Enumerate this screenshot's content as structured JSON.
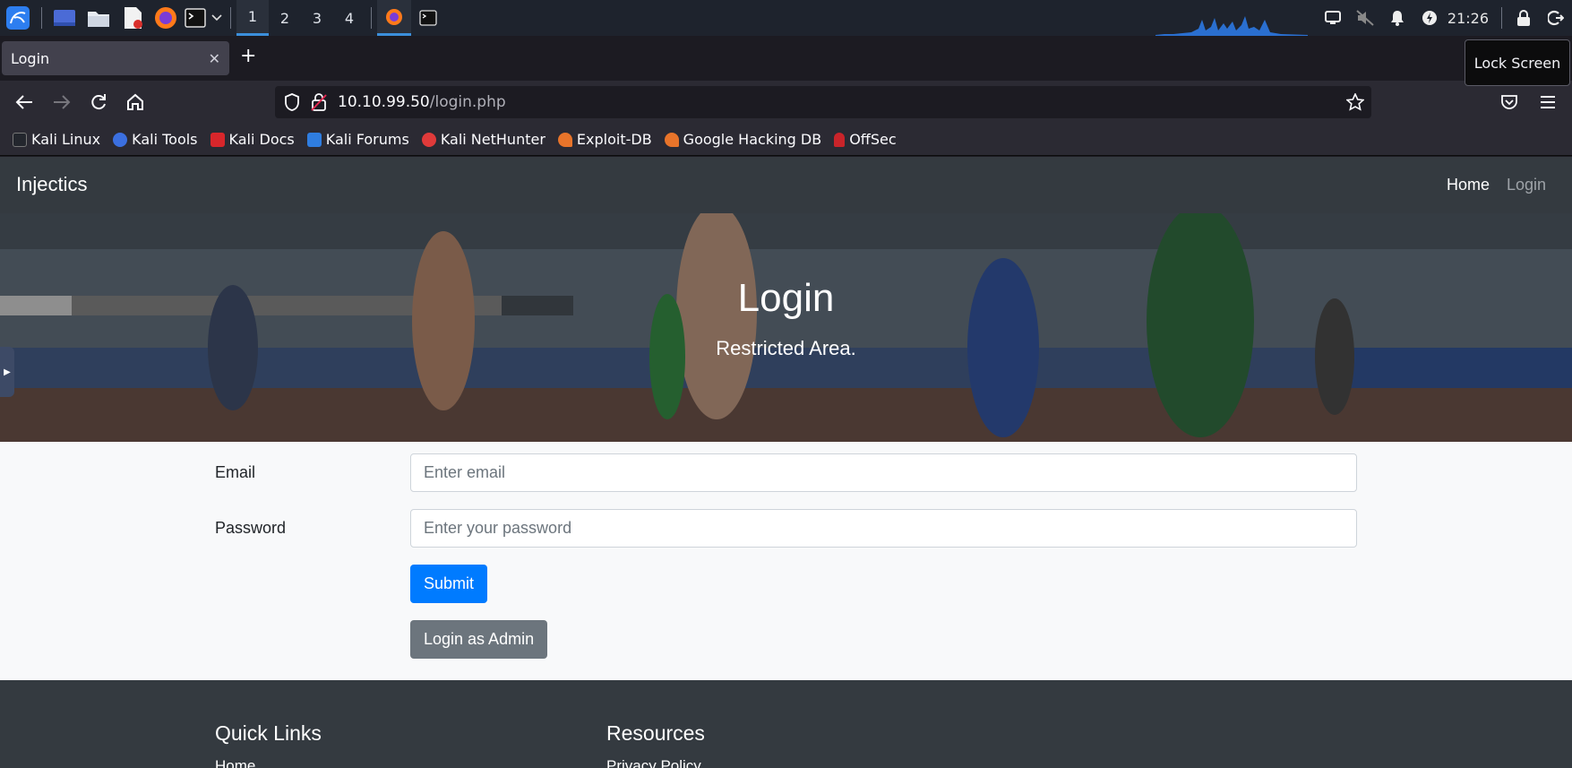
{
  "taskbar": {
    "workspaces": [
      "1",
      "2",
      "3",
      "4"
    ],
    "clock": "21:26"
  },
  "browser": {
    "tab_title": "Login",
    "tooltip": "Lock Screen",
    "url_host": "10.10.99.50",
    "url_path": "/login.php",
    "bookmarks": [
      "Kali Linux",
      "Kali Tools",
      "Kali Docs",
      "Kali Forums",
      "Kali NetHunter",
      "Exploit-DB",
      "Google Hacking DB",
      "OffSec"
    ]
  },
  "site": {
    "brand": "Injectics",
    "nav": {
      "home": "Home",
      "login": "Login"
    },
    "hero": {
      "title": "Login",
      "subtitle": "Restricted Area."
    },
    "form": {
      "email_label": "Email",
      "email_placeholder": "Enter email",
      "email_value": "",
      "password_label": "Password",
      "password_placeholder": "Enter your password",
      "password_value": "",
      "submit": "Submit",
      "admin": "Login as Admin"
    },
    "footer": {
      "quick_links_title": "Quick Links",
      "quick_links_first": "Home",
      "resources_title": "Resources",
      "resources_first": "Privacy Policy"
    }
  },
  "colors": {
    "primary": "#007bff",
    "secondary": "#6c757d",
    "dark": "#343a40",
    "taskbar_accent": "#3b8fdb"
  }
}
